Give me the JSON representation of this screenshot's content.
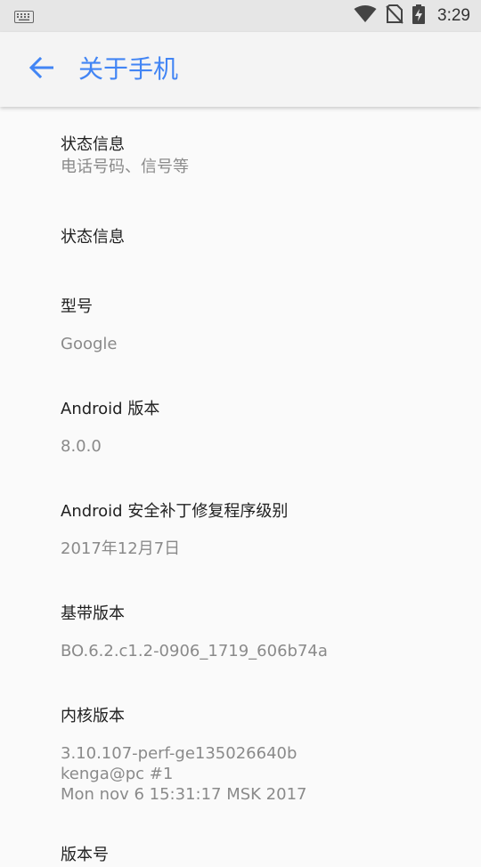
{
  "status_bar": {
    "time": "3:29",
    "icons": [
      "keyboard-icon",
      "wifi-icon",
      "no-sim-icon",
      "battery-charging-icon"
    ]
  },
  "app_bar": {
    "title": "关于手机",
    "back_icon": "arrow-back-icon",
    "accent_color": "#4285f4"
  },
  "items": [
    {
      "title": "状态信息",
      "subtitle": "电话号码、信号等"
    },
    {
      "title": "状态信息",
      "subtitle": ""
    },
    {
      "title": "型号",
      "subtitle": "Google"
    },
    {
      "title": "Android 版本",
      "subtitle": "8.0.0"
    },
    {
      "title": "Android 安全补丁修复程序级别",
      "subtitle": "2017年12月7日"
    },
    {
      "title": "基带版本",
      "subtitle": "BO.6.2.c1.2-0906_1719_606b74a"
    },
    {
      "title": "内核版本",
      "subtitle_lines": [
        "3.10.107-perf-ge135026640b",
        "kenga@pc #1",
        "Mon nov 6 15:31:17 MSK 2017"
      ]
    },
    {
      "title": "版本号",
      "subtitle": ""
    }
  ]
}
